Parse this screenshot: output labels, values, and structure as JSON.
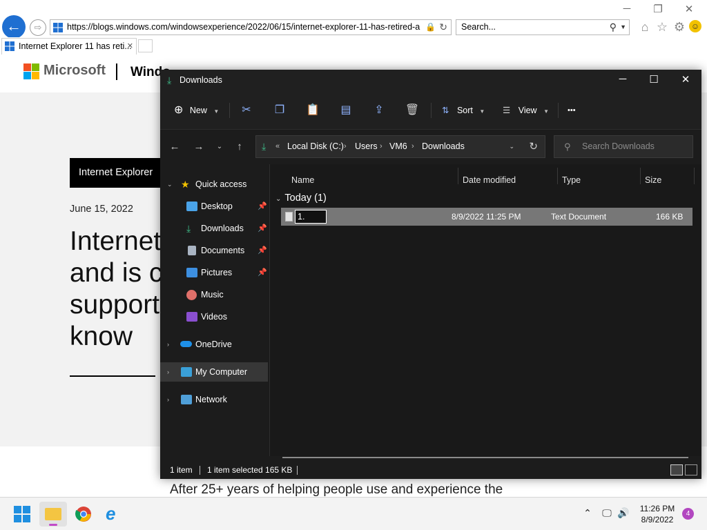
{
  "ie": {
    "url": "https://blogs.windows.com/windowsexperience/2022/06/15/internet-explorer-11-has-retired-a",
    "search_placeholder": "Search...",
    "tab_title": "Internet Explorer 11 has reti...",
    "back_icon": "back-arrow-icon",
    "forward_icon": "forward-arrow-icon"
  },
  "webpage": {
    "brand": "Microsoft",
    "section": "Windo",
    "category": "Internet Explorer",
    "date": "June 15, 2022",
    "title_lines": [
      "Internet",
      "and is c",
      "support",
      "know"
    ],
    "body_start": "After 25+ years of helping people use and experience the"
  },
  "explorer": {
    "window_title": "Downloads",
    "commands": {
      "new": "New",
      "sort": "Sort",
      "view": "View",
      "more": "•••"
    },
    "address": {
      "overflow": "«",
      "crumbs": [
        "Local Disk (C:)",
        "Users",
        "VM6",
        "Downloads"
      ]
    },
    "search_placeholder": "Search Downloads",
    "nav": {
      "quick_access": "Quick access",
      "desktop": "Desktop",
      "downloads": "Downloads",
      "documents": "Documents",
      "pictures": "Pictures",
      "music": "Music",
      "videos": "Videos",
      "onedrive": "OneDrive",
      "my_computer": "My Computer",
      "network": "Network"
    },
    "columns": {
      "name": "Name",
      "date_modified": "Date modified",
      "type": "Type",
      "size": "Size"
    },
    "group": "Today (1)",
    "file": {
      "rename_value": "1.",
      "date_modified": "8/9/2022 11:25 PM",
      "type": "Text Document",
      "size": "166 KB"
    },
    "status": {
      "count": "1 item",
      "selection": "1 item selected  165 KB"
    }
  },
  "taskbar": {
    "time": "11:26 PM",
    "date": "8/9/2022",
    "notifications": "4"
  },
  "colors": {
    "accent_blue": "#1f6fd1",
    "explorer_bg": "#1c1c1c",
    "downloads_green": "#3fbf8b",
    "selection_row": "#777777",
    "notification": "#b247c0"
  }
}
